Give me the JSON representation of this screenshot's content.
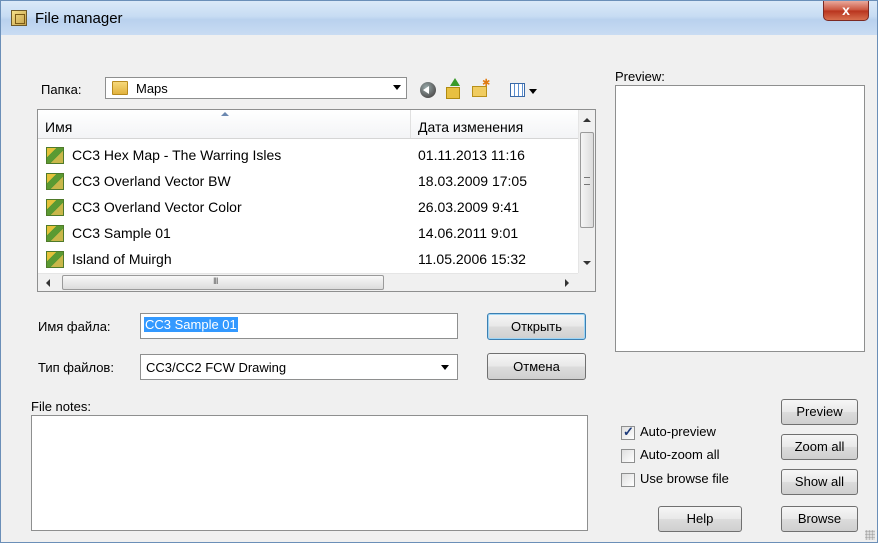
{
  "window": {
    "title": "File manager",
    "close_label": "x"
  },
  "location": {
    "label": "Папка:",
    "folder": "Maps"
  },
  "toolbar": {
    "icons": [
      "back-icon",
      "up-folder-icon",
      "new-folder-icon",
      "view-menu-icon"
    ]
  },
  "file_list": {
    "columns": [
      "Имя",
      "Дата изменения"
    ],
    "rows": [
      {
        "name": "CC3 Hex Map - The Warring Isles",
        "date": "01.11.2013 11:16"
      },
      {
        "name": "CC3 Overland Vector BW",
        "date": "18.03.2009 17:05"
      },
      {
        "name": "CC3 Overland Vector Color",
        "date": "26.03.2009 9:41"
      },
      {
        "name": "CC3 Sample 01",
        "date": "14.06.2011 9:01"
      },
      {
        "name": "Island of Muirgh",
        "date": "11.05.2006 15:32"
      }
    ]
  },
  "filename": {
    "label": "Имя файла:",
    "value": "CC3 Sample 01"
  },
  "filetype": {
    "label": "Тип файлов:",
    "value": "CC3/CC2 FCW Drawing"
  },
  "buttons": {
    "open": "Открыть",
    "cancel": "Отмена",
    "help": "Help",
    "preview": "Preview",
    "zoom_all": "Zoom all",
    "show_all": "Show all",
    "browse": "Browse"
  },
  "file_notes": {
    "label": "File notes:",
    "value": ""
  },
  "preview": {
    "label": "Preview:"
  },
  "options": [
    {
      "label": "Auto-preview",
      "checked": true
    },
    {
      "label": "Auto-zoom all",
      "checked": false
    },
    {
      "label": "Use browse file",
      "checked": false
    }
  ],
  "colors": {
    "selection": "#3399ff",
    "title_bar": "#c7dcf3",
    "close_button": "#c9513a"
  }
}
